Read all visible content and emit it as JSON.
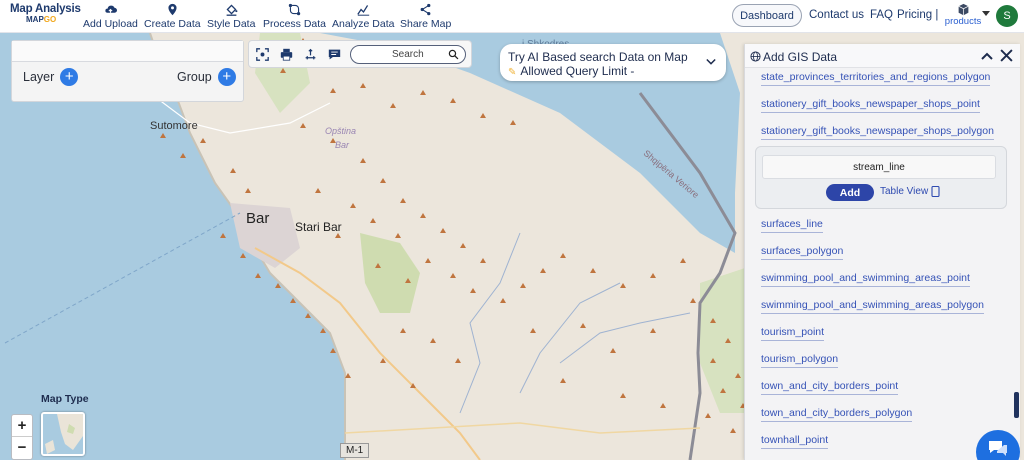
{
  "topbar": {
    "logo_top": "Map Analysis",
    "logo_bottom_a": "MAP",
    "logo_bottom_b": "GO",
    "nav": [
      {
        "label": "Add Upload",
        "icon": "cloud-upload-icon"
      },
      {
        "label": "Create Data",
        "icon": "location-pin-icon"
      },
      {
        "label": "Style Data",
        "icon": "paint-bucket-icon"
      },
      {
        "label": "Process Data",
        "icon": "process-nodes-icon"
      },
      {
        "label": "Analyze Data",
        "icon": "analytics-icon"
      },
      {
        "label": "Share Map",
        "icon": "share-icon"
      }
    ],
    "dashboard": "Dashboard",
    "contact": "Contact us",
    "faq": "FAQ",
    "pricing": "Pricing |",
    "products": "products",
    "avatar_letter": "S"
  },
  "layer_panel": {
    "layer_label": "Layer",
    "group_label": "Group"
  },
  "toolbar": {
    "search_label": "Search"
  },
  "ai_box": {
    "line1": "Try AI Based search Data on Map",
    "line2": "Allowed Query Limit -"
  },
  "gis_panel": {
    "title": "Add GIS Data",
    "items_top": [
      "state_provinces_territories_and_regions_polygon",
      "stationery_gift_books_newspaper_shops_point",
      "stationery_gift_books_newspaper_shops_polygon"
    ],
    "card": {
      "layer_name": "stream_line",
      "add_label": "Add",
      "table_view_label": "Table View"
    },
    "items_bottom": [
      "surfaces_line",
      "surfaces_polygon",
      "swimming_pool_and_swimming_areas_point",
      "swimming_pool_and_swimming_areas_polygon",
      "tourism_point",
      "tourism_polygon",
      "town_and_city_borders_point",
      "town_and_city_borders_polygon",
      "townhall_point"
    ]
  },
  "map": {
    "labels": {
      "sutomore": "Sutomore",
      "opstina": "Opština",
      "bar_small": "Bar",
      "bar": "Bar",
      "stari_bar": "Stari Bar",
      "shqiperia": "Shqipëria Veriore",
      "shkodres": "i Shkodres",
      "road": "M-1"
    },
    "map_type_label": "Map Type",
    "zoom_in": "+",
    "zoom_out": "−"
  },
  "colors": {
    "accent": "#2f7be5",
    "navy": "#1e3a6d",
    "link": "#3552b6",
    "add_button": "#2d45a8",
    "sea": "#a9cbe0",
    "land": "#ece6dc",
    "peak": "#c0753f"
  }
}
